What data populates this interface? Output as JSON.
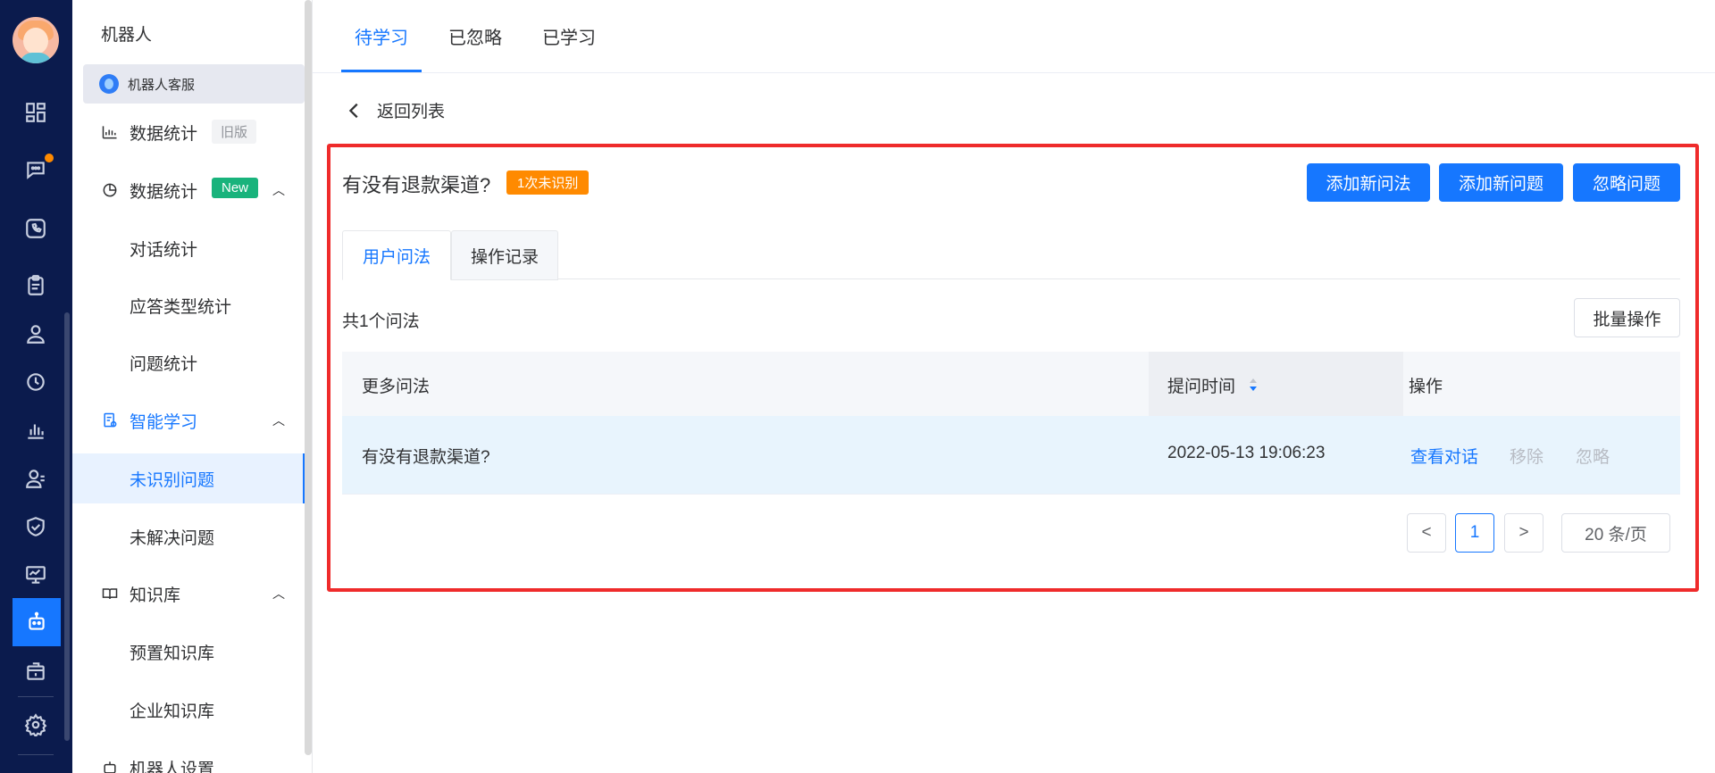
{
  "rail": {
    "icons": [
      "dashboard-icon",
      "chat-icon",
      "phone-icon",
      "clipboard-icon",
      "user-icon",
      "history-icon",
      "bar-chart-icon",
      "contacts-icon",
      "shield-icon",
      "monitor-icon",
      "robot-icon",
      "package-icon",
      "settings-icon"
    ],
    "active": "robot-icon"
  },
  "menu": {
    "title": "机器人",
    "bot_name": "机器人客服",
    "items": [
      {
        "label": "数据统计",
        "tag": "旧版"
      },
      {
        "label": "数据统计",
        "tag": "New"
      },
      {
        "label": "对话统计"
      },
      {
        "label": "应答类型统计"
      },
      {
        "label": "问题统计"
      },
      {
        "label": "智能学习"
      },
      {
        "label": "未识别问题"
      },
      {
        "label": "未解决问题"
      },
      {
        "label": "知识库"
      },
      {
        "label": "预置知识库"
      },
      {
        "label": "企业知识库"
      },
      {
        "label": "机器人设置"
      }
    ]
  },
  "tabs": [
    "待学习",
    "已忽略",
    "已学习"
  ],
  "back_label": "返回列表",
  "question": {
    "title": "有没有退款渠道?",
    "badge": "1次未识别"
  },
  "actions": {
    "add_phrasing": "添加新问法",
    "add_question": "添加新问题",
    "ignore_question": "忽略问题"
  },
  "subtabs": [
    "用户问法",
    "操作记录"
  ],
  "count_label": "共1个问法",
  "batch_label": "批量操作",
  "table": {
    "headers": [
      "更多问法",
      "提问时间",
      "操作"
    ],
    "rows": [
      {
        "phrasing": "有没有退款渠道?",
        "time": "2022-05-13 19:06:23",
        "actions": [
          "查看对话",
          "移除",
          "忽略"
        ]
      }
    ]
  },
  "pagination": {
    "prev": "<",
    "page": "1",
    "next": ">",
    "page_size": "20 条/页"
  },
  "colors": {
    "primary": "#1677ff",
    "rail": "#0b1b4d",
    "badge": "#ff8a00",
    "new_tag": "#19b37c",
    "highlight_border": "#ef2b2b"
  }
}
